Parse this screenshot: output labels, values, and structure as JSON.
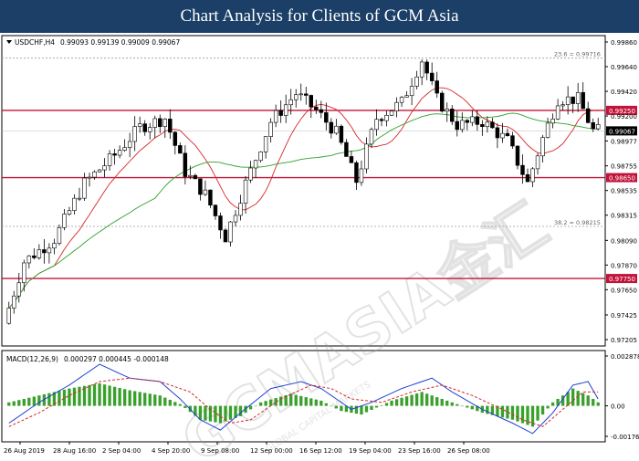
{
  "banner": {
    "title": "Chart Analysis for Clients of GCM Asia"
  },
  "colors": {
    "banner": "#1b3f66",
    "resistance_line": "#c2143a",
    "ma_fast": "#d62728",
    "ma_slow": "#2ca02c",
    "bull": "#ffffff",
    "bear": "#000000",
    "macd_line": "#1f3fd6",
    "signal_line": "#d62728",
    "histogram": "#3aa02c"
  },
  "chart_data": [
    {
      "type": "candlestick",
      "title": "USDCHF,H4",
      "ohlc_readout": [
        "0.99093",
        "0.99139",
        "0.99009",
        "0.99067"
      ],
      "ylim": [
        0.97205,
        0.9986
      ],
      "y_ticks": [
        "0.99860",
        "0.99640",
        "0.99420",
        "0.99200",
        "0.98977",
        "0.98755",
        "0.98535",
        "0.98315",
        "0.98090",
        "0.97870",
        "0.97650",
        "0.97425",
        "0.97205"
      ],
      "x_ticks": [
        "26 Aug 2019",
        "28 Aug 16:00",
        "2 Sep 04:00",
        "4 Sep 20:00",
        "9 Sep 08:00",
        "12 Sep 00:00",
        "16 Sep 12:00",
        "19 Sep 04:00",
        "23 Sep 16:00",
        "26 Sep 08:00"
      ],
      "levels": [
        {
          "value": 0.9925,
          "label": "0.99250",
          "kind": "support_resistance"
        },
        {
          "value": 0.9865,
          "label": "0.98650",
          "kind": "support_resistance"
        },
        {
          "value": 0.9775,
          "label": "0.97750",
          "kind": "support_resistance"
        }
      ],
      "fib_levels": [
        {
          "value": 0.99716,
          "label": "23.6 = 0.99716"
        },
        {
          "value": 0.98215,
          "label": "38.2 = 0.98215"
        }
      ],
      "current_price": {
        "value": 0.99067,
        "label": "0.99067"
      },
      "series_anchors": [
        {
          "t": 0,
          "p": 0.9735
        },
        {
          "t": 4,
          "p": 0.979
        },
        {
          "t": 10,
          "p": 0.981
        },
        {
          "t": 16,
          "p": 0.986
        },
        {
          "t": 22,
          "p": 0.9885
        },
        {
          "t": 27,
          "p": 0.991
        },
        {
          "t": 32,
          "p": 0.9918
        },
        {
          "t": 36,
          "p": 0.987
        },
        {
          "t": 40,
          "p": 0.985
        },
        {
          "t": 44,
          "p": 0.9812
        },
        {
          "t": 48,
          "p": 0.986
        },
        {
          "t": 53,
          "p": 0.9915
        },
        {
          "t": 58,
          "p": 0.994
        },
        {
          "t": 62,
          "p": 0.9925
        },
        {
          "t": 66,
          "p": 0.9905
        },
        {
          "t": 70,
          "p": 0.9862
        },
        {
          "t": 74,
          "p": 0.9918
        },
        {
          "t": 79,
          "p": 0.9932
        },
        {
          "t": 83,
          "p": 0.997
        },
        {
          "t": 86,
          "p": 0.9935
        },
        {
          "t": 90,
          "p": 0.9912
        },
        {
          "t": 95,
          "p": 0.9915
        },
        {
          "t": 100,
          "p": 0.9898
        },
        {
          "t": 104,
          "p": 0.986
        },
        {
          "t": 107,
          "p": 0.99
        },
        {
          "t": 110,
          "p": 0.9935
        },
        {
          "t": 114,
          "p": 0.9935
        },
        {
          "t": 117,
          "p": 0.9907
        }
      ],
      "candle_count": 118
    },
    {
      "type": "line",
      "title": "MACD(12,26,9)",
      "readout": [
        "0.000297",
        "0.000445",
        "-0.000148"
      ],
      "ylim": [
        -0.001762,
        0.002878
      ],
      "y_ticks": [
        "0.002878",
        "0.00",
        "-0.001762"
      ],
      "histogram": [
        {
          "t": 0,
          "v": 0.0002
        },
        {
          "t": 6,
          "v": 0.0006
        },
        {
          "t": 12,
          "v": 0.001
        },
        {
          "t": 18,
          "v": 0.0013
        },
        {
          "t": 24,
          "v": 0.0009
        },
        {
          "t": 30,
          "v": 0.0006
        },
        {
          "t": 34,
          "v": 0.0001
        },
        {
          "t": 38,
          "v": -0.0008
        },
        {
          "t": 42,
          "v": -0.001
        },
        {
          "t": 46,
          "v": -0.0006
        },
        {
          "t": 50,
          "v": 0.0002
        },
        {
          "t": 56,
          "v": 0.0007
        },
        {
          "t": 62,
          "v": 0.0003
        },
        {
          "t": 66,
          "v": -0.0003
        },
        {
          "t": 70,
          "v": -0.0005
        },
        {
          "t": 76,
          "v": 0.0003
        },
        {
          "t": 82,
          "v": 0.0008
        },
        {
          "t": 88,
          "v": 0.0002
        },
        {
          "t": 94,
          "v": -0.0004
        },
        {
          "t": 100,
          "v": -0.0008
        },
        {
          "t": 104,
          "v": -0.0012
        },
        {
          "t": 108,
          "v": 0.0002
        },
        {
          "t": 112,
          "v": 0.001
        },
        {
          "t": 115,
          "v": 0.0006
        },
        {
          "t": 117,
          "v": 0.0002
        }
      ],
      "macd_line": [
        {
          "t": 0,
          "v": -0.001
        },
        {
          "t": 6,
          "v": 0.0002
        },
        {
          "t": 12,
          "v": 0.0012
        },
        {
          "t": 18,
          "v": 0.0024
        },
        {
          "t": 24,
          "v": 0.0016
        },
        {
          "t": 30,
          "v": 0.0014
        },
        {
          "t": 34,
          "v": 0.0004
        },
        {
          "t": 38,
          "v": -0.0008
        },
        {
          "t": 42,
          "v": -0.0014
        },
        {
          "t": 46,
          "v": -0.0004
        },
        {
          "t": 52,
          "v": 0.001
        },
        {
          "t": 58,
          "v": 0.0014
        },
        {
          "t": 62,
          "v": 0.001
        },
        {
          "t": 68,
          "v": -0.0002
        },
        {
          "t": 72,
          "v": 0.0002
        },
        {
          "t": 78,
          "v": 0.001
        },
        {
          "t": 84,
          "v": 0.0016
        },
        {
          "t": 88,
          "v": 0.0008
        },
        {
          "t": 94,
          "v": -0.0002
        },
        {
          "t": 100,
          "v": -0.001
        },
        {
          "t": 104,
          "v": -0.0016
        },
        {
          "t": 108,
          "v": -0.0004
        },
        {
          "t": 112,
          "v": 0.0012
        },
        {
          "t": 115,
          "v": 0.0014
        },
        {
          "t": 117,
          "v": 0.0004
        }
      ],
      "signal_line": [
        {
          "t": 0,
          "v": -0.0012
        },
        {
          "t": 6,
          "v": -0.0004
        },
        {
          "t": 12,
          "v": 0.0006
        },
        {
          "t": 18,
          "v": 0.0014
        },
        {
          "t": 24,
          "v": 0.0016
        },
        {
          "t": 30,
          "v": 0.0014
        },
        {
          "t": 36,
          "v": 0.0008
        },
        {
          "t": 40,
          "v": -0.0002
        },
        {
          "t": 44,
          "v": -0.001
        },
        {
          "t": 48,
          "v": -0.0008
        },
        {
          "t": 54,
          "v": 0.0004
        },
        {
          "t": 60,
          "v": 0.0012
        },
        {
          "t": 64,
          "v": 0.001
        },
        {
          "t": 68,
          "v": 0.0004
        },
        {
          "t": 74,
          "v": 0.0002
        },
        {
          "t": 80,
          "v": 0.0008
        },
        {
          "t": 86,
          "v": 0.0012
        },
        {
          "t": 92,
          "v": 0.0006
        },
        {
          "t": 98,
          "v": -0.0002
        },
        {
          "t": 102,
          "v": -0.0008
        },
        {
          "t": 106,
          "v": -0.0012
        },
        {
          "t": 110,
          "v": -0.0002
        },
        {
          "t": 114,
          "v": 0.0008
        },
        {
          "t": 117,
          "v": 0.0008
        }
      ]
    }
  ]
}
